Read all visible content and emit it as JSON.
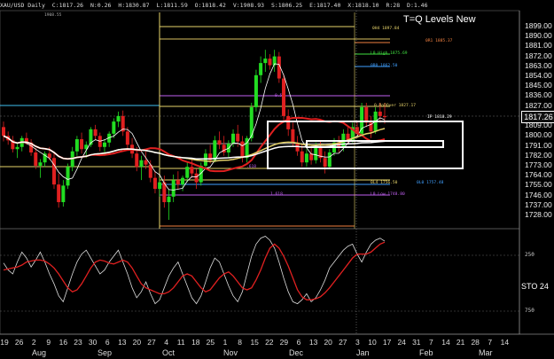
{
  "header": {
    "instrument": "XAU/USD Daily",
    "close": "C:1817.26",
    "net": "N:0.26",
    "high": "H:1830.87",
    "low": "L:1811.59",
    "open": "O:1818.42",
    "v": "V:1908.93",
    "s": "S:1806.25",
    "e": "E:1817.40",
    "x": "X:1818.10",
    "r": "R:28",
    "d": "D:1.46"
  },
  "chart_title": "T=Q Levels New",
  "price_axis": [
    "1899.00",
    "1890.00",
    "1881.00",
    "1872.00",
    "1863.00",
    "1854.00",
    "1845.00",
    "1836.00",
    "1827.00",
    "1809.00",
    "1800.00",
    "1791.00",
    "1782.00",
    "1773.00",
    "1764.00",
    "1755.00",
    "1746.00",
    "1737.00",
    "1728.00"
  ],
  "current_price": "1817.26",
  "stochastic": {
    "label": "STO 24",
    "levels": [
      "250",
      "750"
    ]
  },
  "date_axis": [
    "19",
    "26",
    "2",
    "9",
    "16",
    "23",
    "30",
    "6",
    "13",
    "20",
    "27",
    "4",
    "11",
    "18",
    "25",
    "1",
    "8",
    "15",
    "22",
    "29",
    "6",
    "13",
    "20",
    "27",
    "3",
    "10",
    "17",
    "24",
    "31",
    "7",
    "14",
    "21",
    "28",
    "7",
    "14"
  ],
  "month_axis": [
    "Aug",
    "Sep",
    "Oct",
    "Nov",
    "Dec",
    "Jan",
    "Feb",
    "Mar"
  ],
  "level_tags": [
    {
      "text": "0H4 1897.84",
      "color": "#e6d36a"
    },
    {
      "text": "0R1 1885.37",
      "color": "#f08040"
    },
    {
      "text": "L0 High 1875.69",
      "color": "#40e040"
    },
    {
      "text": "0R0 1862.50",
      "color": "#40a0ff"
    },
    {
      "text": "0.5",
      "color": "#c060f0"
    },
    {
      "text": "0 RoDOver 1827.17",
      "color": "#e6d36a"
    },
    {
      "text": "IP 1818.29",
      "color": "#ffffff"
    },
    {
      "text": "0L4 1756.50",
      "color": "#e6d36a"
    },
    {
      "text": "0L0 1757.48",
      "color": "#40a0ff"
    },
    {
      "text": "L0 Low 1748.80",
      "color": "#c060f0"
    },
    {
      "text": "1.618",
      "color": "#c060f0"
    },
    {
      "text": ".618",
      "color": "#c060f0"
    },
    {
      "text": "1908.55",
      "color": "#aaaaaa"
    }
  ],
  "candles": [
    [
      1808,
      1813,
      1795,
      1800
    ],
    [
      1800,
      1804,
      1792,
      1796
    ],
    [
      1796,
      1800,
      1785,
      1788
    ],
    [
      1788,
      1793,
      1780,
      1790
    ],
    [
      1790,
      1800,
      1786,
      1798
    ],
    [
      1798,
      1803,
      1792,
      1794
    ],
    [
      1794,
      1797,
      1782,
      1785
    ],
    [
      1785,
      1789,
      1770,
      1773
    ],
    [
      1773,
      1779,
      1762,
      1776
    ],
    [
      1776,
      1786,
      1772,
      1784
    ],
    [
      1784,
      1790,
      1778,
      1780
    ],
    [
      1780,
      1784,
      1752,
      1756
    ],
    [
      1756,
      1766,
      1735,
      1740
    ],
    [
      1740,
      1760,
      1736,
      1755
    ],
    [
      1755,
      1775,
      1752,
      1772
    ],
    [
      1772,
      1790,
      1768,
      1786
    ],
    [
      1786,
      1800,
      1782,
      1797
    ],
    [
      1797,
      1803,
      1784,
      1788
    ],
    [
      1788,
      1795,
      1780,
      1792
    ],
    [
      1792,
      1808,
      1790,
      1806
    ],
    [
      1806,
      1810,
      1796,
      1800
    ],
    [
      1800,
      1803,
      1786,
      1790
    ],
    [
      1790,
      1797,
      1782,
      1794
    ],
    [
      1794,
      1804,
      1790,
      1802
    ],
    [
      1802,
      1816,
      1798,
      1813
    ],
    [
      1813,
      1822,
      1808,
      1818
    ],
    [
      1818,
      1823,
      1800,
      1804
    ],
    [
      1804,
      1808,
      1788,
      1792
    ],
    [
      1792,
      1798,
      1780,
      1784
    ],
    [
      1784,
      1790,
      1768,
      1772
    ],
    [
      1772,
      1782,
      1760,
      1778
    ],
    [
      1778,
      1786,
      1770,
      1774
    ],
    [
      1774,
      1778,
      1758,
      1762
    ],
    [
      1762,
      1768,
      1748,
      1752
    ],
    [
      1752,
      1762,
      1745,
      1758
    ],
    [
      1758,
      1764,
      1735,
      1740
    ],
    [
      1740,
      1752,
      1724,
      1745
    ],
    [
      1745,
      1765,
      1740,
      1760
    ],
    [
      1760,
      1768,
      1752,
      1756
    ],
    [
      1756,
      1764,
      1750,
      1762
    ],
    [
      1762,
      1776,
      1758,
      1772
    ],
    [
      1772,
      1780,
      1762,
      1766
    ],
    [
      1766,
      1770,
      1752,
      1758
    ],
    [
      1758,
      1776,
      1755,
      1773
    ],
    [
      1773,
      1788,
      1770,
      1784
    ],
    [
      1784,
      1792,
      1775,
      1778
    ],
    [
      1778,
      1800,
      1776,
      1796
    ],
    [
      1796,
      1804,
      1788,
      1792
    ],
    [
      1792,
      1800,
      1782,
      1785
    ],
    [
      1785,
      1796,
      1780,
      1793
    ],
    [
      1793,
      1806,
      1790,
      1802
    ],
    [
      1802,
      1810,
      1790,
      1795
    ],
    [
      1795,
      1800,
      1776,
      1780
    ],
    [
      1780,
      1800,
      1776,
      1798
    ],
    [
      1798,
      1830,
      1795,
      1826
    ],
    [
      1826,
      1860,
      1822,
      1855
    ],
    [
      1855,
      1872,
      1848,
      1866
    ],
    [
      1866,
      1878,
      1858,
      1870
    ],
    [
      1870,
      1874,
      1860,
      1864
    ],
    [
      1864,
      1878,
      1858,
      1872
    ],
    [
      1872,
      1876,
      1848,
      1852
    ],
    [
      1852,
      1856,
      1812,
      1818
    ],
    [
      1818,
      1824,
      1800,
      1806
    ],
    [
      1806,
      1812,
      1790,
      1794
    ],
    [
      1794,
      1800,
      1782,
      1786
    ],
    [
      1786,
      1792,
      1772,
      1776
    ],
    [
      1776,
      1788,
      1772,
      1784
    ],
    [
      1784,
      1790,
      1774,
      1778
    ],
    [
      1778,
      1794,
      1775,
      1790
    ],
    [
      1790,
      1795,
      1776,
      1780
    ],
    [
      1780,
      1786,
      1766,
      1772
    ],
    [
      1772,
      1788,
      1770,
      1785
    ],
    [
      1785,
      1798,
      1782,
      1794
    ],
    [
      1794,
      1800,
      1785,
      1790
    ],
    [
      1790,
      1806,
      1786,
      1802
    ],
    [
      1802,
      1808,
      1792,
      1796
    ],
    [
      1796,
      1812,
      1794,
      1808
    ],
    [
      1808,
      1813,
      1798,
      1802
    ],
    [
      1802,
      1830,
      1800,
      1826
    ],
    [
      1826,
      1830,
      1808,
      1812
    ],
    [
      1812,
      1818,
      1798,
      1804
    ],
    [
      1804,
      1826,
      1802,
      1822
    ],
    [
      1822,
      1830,
      1812,
      1818
    ],
    [
      1818,
      1830,
      1811,
      1817
    ]
  ],
  "stoch": [
    310,
    380,
    420,
    300,
    200,
    260,
    350,
    280,
    200,
    300,
    420,
    520,
    640,
    700,
    560,
    420,
    300,
    220,
    180,
    260,
    340,
    420,
    380,
    300,
    240,
    180,
    300,
    420,
    560,
    660,
    600,
    500,
    620,
    720,
    680,
    560,
    440,
    360,
    300,
    420,
    540,
    660,
    720,
    640,
    500,
    360,
    260,
    300,
    420,
    540,
    640,
    700,
    600,
    420,
    240,
    120,
    60,
    40,
    80,
    160,
    300,
    460,
    600,
    700,
    720,
    680,
    620,
    700,
    660,
    580,
    480,
    360,
    300,
    240,
    180,
    140,
    120,
    220,
    300,
    200,
    120,
    80,
    60,
    90
  ],
  "stoch_signal": [
    380,
    370,
    360,
    350,
    330,
    300,
    290,
    280,
    280,
    290,
    320,
    360,
    420,
    490,
    560,
    600,
    580,
    520,
    440,
    360,
    300,
    280,
    290,
    310,
    320,
    300,
    280,
    300,
    360,
    440,
    520,
    560,
    580,
    600,
    620,
    620,
    600,
    560,
    500,
    440,
    420,
    440,
    500,
    560,
    600,
    580,
    520,
    460,
    420,
    400,
    440,
    500,
    560,
    580,
    560,
    480,
    380,
    260,
    160,
    120,
    160,
    240,
    340,
    460,
    580,
    650,
    680,
    680,
    670,
    650,
    610,
    560,
    500,
    440,
    380,
    320,
    260,
    220,
    220,
    220,
    200,
    160,
    120,
    100
  ]
}
